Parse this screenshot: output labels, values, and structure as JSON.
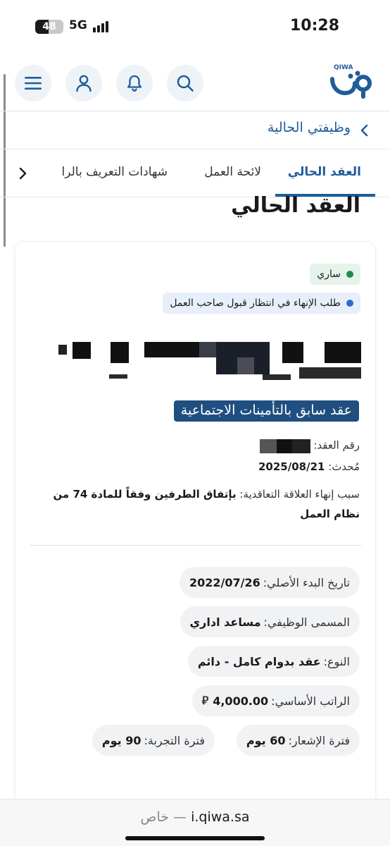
{
  "status_bar": {
    "battery": "48",
    "battery_level": 0.48,
    "network": "5G",
    "time": "10:28"
  },
  "header": {
    "logo_text": "QIWA",
    "icons": [
      "menu-icon",
      "user-icon",
      "bell-icon",
      "search-icon"
    ]
  },
  "breadcrumb": {
    "label": "وظيفتي الحالية"
  },
  "tabs": [
    {
      "label": "العقد الحالي",
      "active": true
    },
    {
      "label": "لائحة العمل",
      "active": false
    },
    {
      "label": "شهادات التعريف بالرا",
      "active": false
    }
  ],
  "page_heading": "العقد الحالي",
  "card": {
    "status_badge": "ساري",
    "termination_badge": "طلب الإنهاء في انتظار قبول صاحب العمل",
    "previous_contract_badge": "عقد سابق بالتأمينات الاجتماعية",
    "contract_number_label": "رقم العقد:",
    "updated_label": "مُحدث:",
    "updated_value": "2025/08/21",
    "reason_label": "سبب إنهاء العلاقة التعاقدية:",
    "reason_value": "بإتفاق الطرفين وفقاً للمادة 74 من نظام العمل",
    "details": [
      {
        "label": "تاريخ البدء الأصلي:",
        "value": "2022/07/26"
      },
      {
        "label": "المسمى الوظيفي:",
        "value": "مساعد اداري"
      },
      {
        "label": "النوع:",
        "value": "عقد بدوام كامل - دائم"
      },
      {
        "label": "الراتب الأساسي:",
        "value": "4,000.00",
        "currency": "⃁"
      },
      {
        "label": "فترة الإشعار:",
        "value": "60 يوم"
      },
      {
        "label": "فترة التجربة:",
        "value": "90 يوم"
      }
    ]
  },
  "url_bar": {
    "domain": "i.qiwa.sa",
    "private_label": "خاص —"
  },
  "colors": {
    "brand_blue": "#1f5d9a",
    "dark_blue_badge": "#1f4f80",
    "green_dot": "#1e8a4c",
    "blue_dot": "#2c6ad8"
  }
}
